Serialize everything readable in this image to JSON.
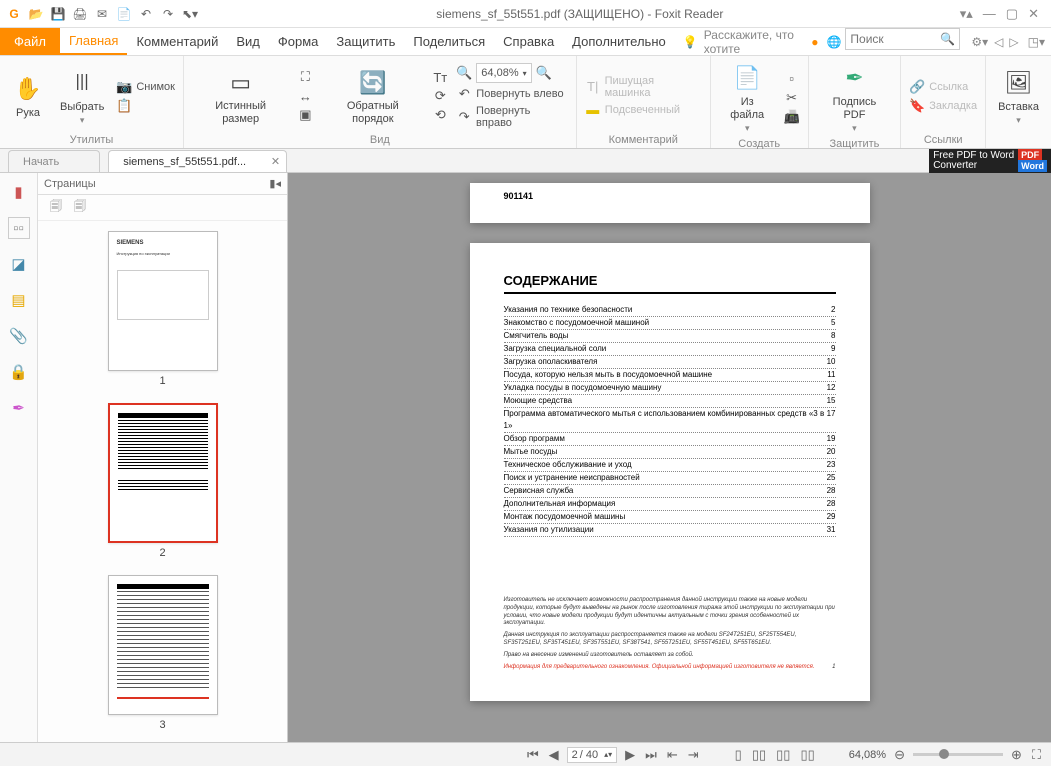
{
  "window": {
    "title": "siemens_sf_55t551.pdf (ЗАЩИЩЕНО) - Foxit Reader"
  },
  "tabs": {
    "file": "Файл",
    "items": [
      "Главная",
      "Комментарий",
      "Вид",
      "Форма",
      "Защитить",
      "Поделиться",
      "Справка",
      "Дополнительно"
    ],
    "active": 0,
    "tellme": "Расскажите, что хотите",
    "search_placeholder": "Поиск"
  },
  "ribbon": {
    "grp_utilities": "Утилиты",
    "hand": "Рука",
    "select": "Выбрать",
    "snapshot": "Снимок",
    "grp_view": "Вид",
    "actual": "Истинный размер",
    "reverse": "Обратный порядок",
    "fit": "Tт",
    "zoom_value": "64,08%",
    "rotate_left": "Повернуть влево",
    "rotate_right": "Повернуть вправо",
    "grp_comment": "Комментарий",
    "typewriter": "Пишущая машинка",
    "highlight": "Подсвеченный",
    "grp_create": "Создать",
    "from_file": "Из файла",
    "grp_protect": "Защитить",
    "sign": "Подпись PDF",
    "grp_links": "Ссылки",
    "link": "Ссылка",
    "bookmark": "Закладка",
    "insert": "Вставка"
  },
  "doctabs": {
    "start": "Начать",
    "file": "siemens_sf_55t551.pdf..."
  },
  "ad": {
    "line1": "Free PDF to Word",
    "line2": "Converter"
  },
  "sidebar": {
    "pages": "Страницы"
  },
  "thumbs": [
    "1",
    "2",
    "3"
  ],
  "page_header": "901141",
  "toc": {
    "title": "СОДЕРЖАНИЕ",
    "items": [
      {
        "t": "Указания по технике безопасности",
        "p": "2"
      },
      {
        "t": "Знакомство с посудомоечной машиной",
        "p": "5"
      },
      {
        "t": "Смягчитель воды",
        "p": "8"
      },
      {
        "t": "Загрузка специальной соли",
        "p": "9"
      },
      {
        "t": "Загрузка ополаскивателя",
        "p": "10"
      },
      {
        "t": "Посуда, которую нельзя мыть в посудомоечной машине",
        "p": "11"
      },
      {
        "t": "Укладка посуды в посудомоечную машину",
        "p": "12"
      },
      {
        "t": "Моющие средства",
        "p": "15"
      },
      {
        "t": "Программа автоматического мытья с использованием комбинированных средств «3 в 1»",
        "p": "17"
      },
      {
        "t": "Обзор программ",
        "p": "19"
      },
      {
        "t": "Мытье посуды",
        "p": "20"
      },
      {
        "t": "Техническое обслуживание и уход",
        "p": "23"
      },
      {
        "t": "Поиск и устранение неисправностей",
        "p": "25"
      },
      {
        "t": "Сервисная служба",
        "p": "28"
      },
      {
        "t": "Дополнительная информация",
        "p": "28"
      },
      {
        "t": "Монтаж посудомоечной машины",
        "p": "29"
      },
      {
        "t": "Указания по утилизации",
        "p": "31"
      }
    ],
    "disclaimer1": "Изготовитель не исключает возможности распространения данной инструкции также на новые модели продукции, которые будут выведены на рынок после изготовления тиража этой инструкции по эксплуатации при условии, что новые модели продукции будут идентичны актуальным с точки зрения особенностей их эксплуатации.",
    "disclaimer2": "Данная инструкция по эксплуатации распространяется также на модели SF24T251EU, SF25T554EU, SF35T251EU, SF35T451EU, SF35T551EU, SF38T541, SF55T251EU, SF55T451EU, SF55T651EU.",
    "disclaimer3": "Право на внесение изменений изготовитель оставляет за собой.",
    "disclaimer4": "Информация для предварительного ознакомления. Официальной информацией изготовителя не является.",
    "pgnum": "1"
  },
  "status": {
    "page_current": "2",
    "page_total": "/ 40",
    "zoom": "64,08%"
  }
}
